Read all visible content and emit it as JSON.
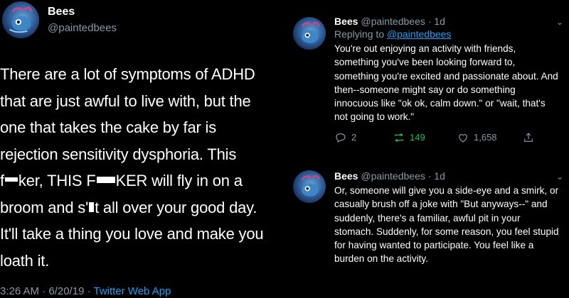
{
  "left_tweet": {
    "name": "Bees",
    "handle": "@paintedbees",
    "lines": [
      "There are a lot of symptoms of ADHD",
      "that are just awful to live with, but the",
      "one that takes the cake by far is",
      "rejection sensitivity dysphoria. This"
    ],
    "line5": {
      "a": "f",
      "b": "ker, THIS F",
      "c": "KER will fly in on a"
    },
    "line6": {
      "a": "broom and s'",
      "b": "t all over your good day."
    },
    "lines_tail": [
      "It'll take a thing you love and make you",
      "loath it."
    ],
    "meta_time": "3:26 AM · 6/20/19 · ",
    "meta_app": "Twitter Web App"
  },
  "reply_tweets": [
    {
      "name": "Bees",
      "handle_time": "@paintedbees · 1d",
      "replying_prefix": "Replying to ",
      "replying_handle": "@paintedbees",
      "text": "You're out enjoying an activity with friends, something you've been looking forward to, something you're excited and passionate about. And then--someone might say or do something innocuous like \"ok ok, calm down.\" or \"wait, that's not going to work.\"",
      "replies": "2",
      "retweets": "149",
      "likes": "1,658"
    },
    {
      "name": "Bees",
      "handle_time": "@paintedbees · 1d",
      "text": "Or, someone will give you a side-eye and a smirk, or casually brush off a joke with \"But anyways--\" and suddenly, there's a familiar, awful pit in your stomach. Suddenly, for some reason, you feel stupid for having wanted to participate. You feel like a burden on the activity."
    }
  ],
  "icons": {
    "avatar": "bee-avatar-icon",
    "more": "chevron-down-icon",
    "reply": "reply-icon",
    "retweet": "retweet-icon",
    "like": "heart-icon",
    "share": "share-icon"
  },
  "colors": {
    "background": "#000000",
    "text": "#ffffff",
    "secondary": "#8899a6",
    "link": "#1da1f2",
    "retweet": "#17bf63"
  }
}
